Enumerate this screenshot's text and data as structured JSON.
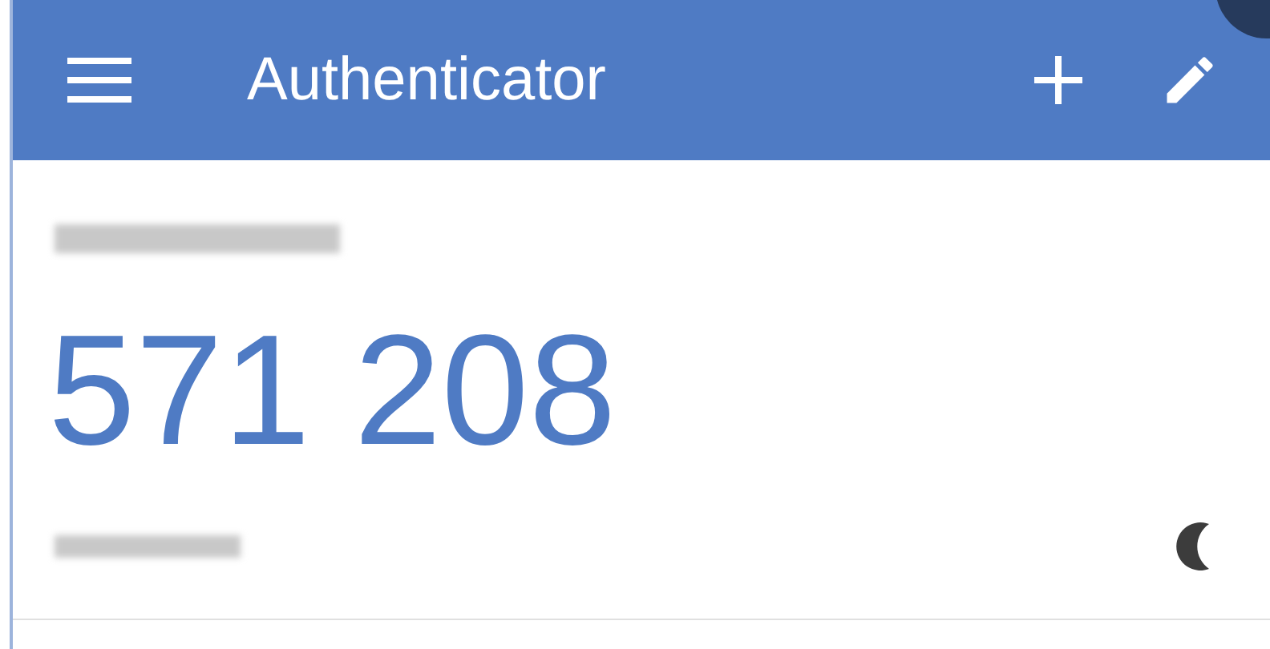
{
  "app_bar": {
    "title": "Authenticator"
  },
  "accounts": [
    {
      "code": "571 208"
    }
  ]
}
